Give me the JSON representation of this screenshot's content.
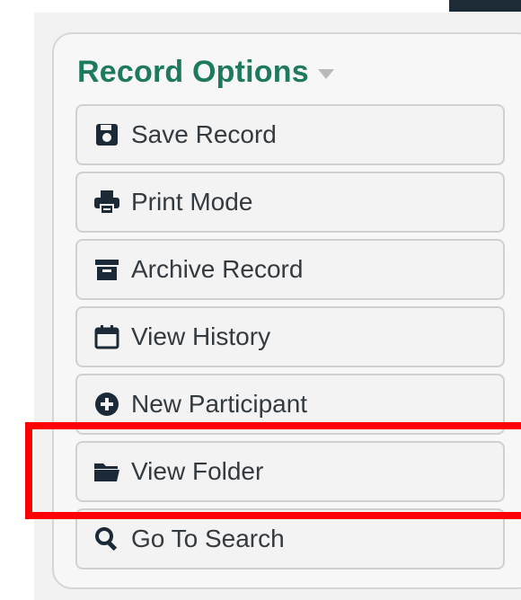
{
  "panel": {
    "title": "Record Options"
  },
  "menu": {
    "items": [
      {
        "label": "Save Record",
        "icon": "save-icon"
      },
      {
        "label": "Print Mode",
        "icon": "print-icon"
      },
      {
        "label": "Archive Record",
        "icon": "archive-icon"
      },
      {
        "label": "View History",
        "icon": "calendar-icon"
      },
      {
        "label": "New Participant",
        "icon": "plus-circle-icon"
      },
      {
        "label": "View Folder",
        "icon": "folder-icon"
      },
      {
        "label": "Go To Search",
        "icon": "search-icon"
      }
    ]
  },
  "colors": {
    "title": "#1d7a5f",
    "icon": "#1b2a36",
    "highlight": "#ff0000"
  }
}
